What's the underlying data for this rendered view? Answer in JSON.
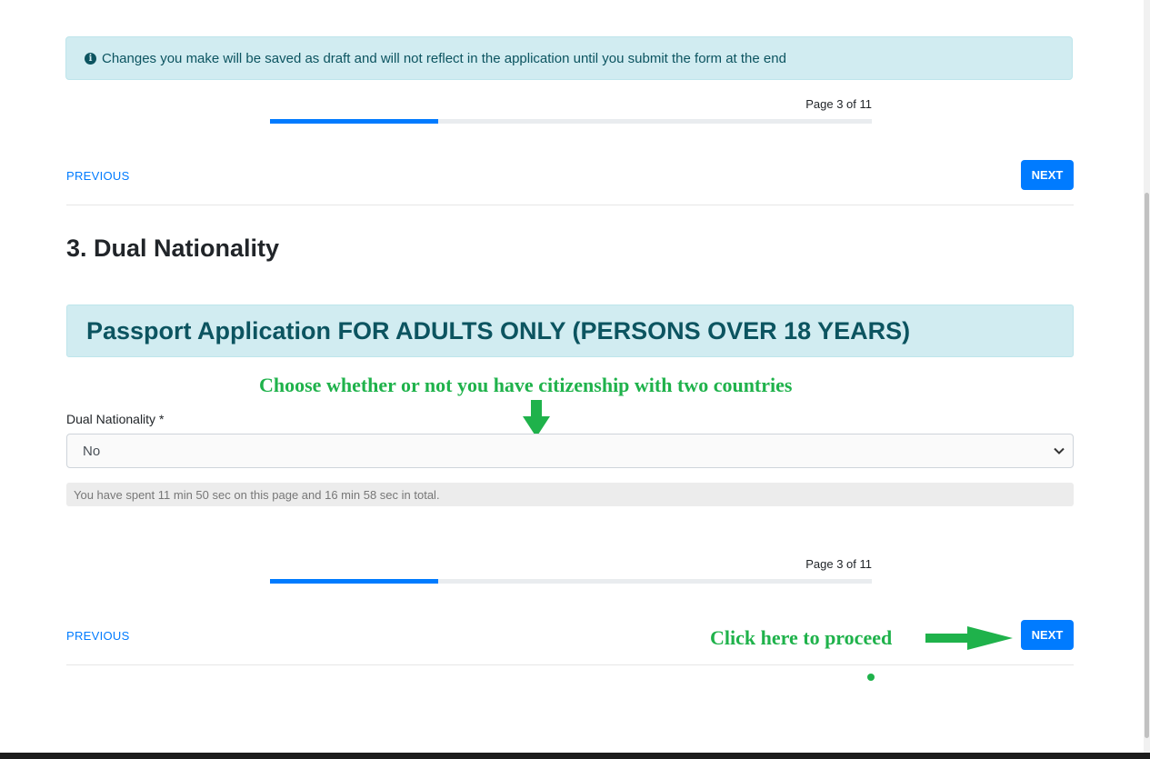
{
  "alert": {
    "icon": "info-circle-icon",
    "text": "Changes you make will be saved as draft and will not reflect in the application until you submit the form at the end"
  },
  "pagination": {
    "label": "Page 3 of 11",
    "current": 3,
    "total": 11,
    "progress_fraction": 0.28
  },
  "nav": {
    "previous_label": "PREVIOUS",
    "next_label": "NEXT"
  },
  "section": {
    "title": "3. Dual Nationality",
    "subheader": "Passport Application FOR ADULTS ONLY (PERSONS OVER 18 YEARS)"
  },
  "form": {
    "dual_nationality_label": "Dual Nationality *",
    "dual_nationality_value": "No"
  },
  "timer": {
    "text": "You have spent 11 min 50 sec on this page and 16 min 58 sec in total."
  },
  "annotations": {
    "choose_text": "Choose whether or not you have citizenship with two countries",
    "proceed_text": "Click here to proceed",
    "color": "#1fb24b"
  },
  "colors": {
    "primary": "#007bff",
    "info_bg": "#d1ecf1",
    "info_text": "#0c5460"
  }
}
